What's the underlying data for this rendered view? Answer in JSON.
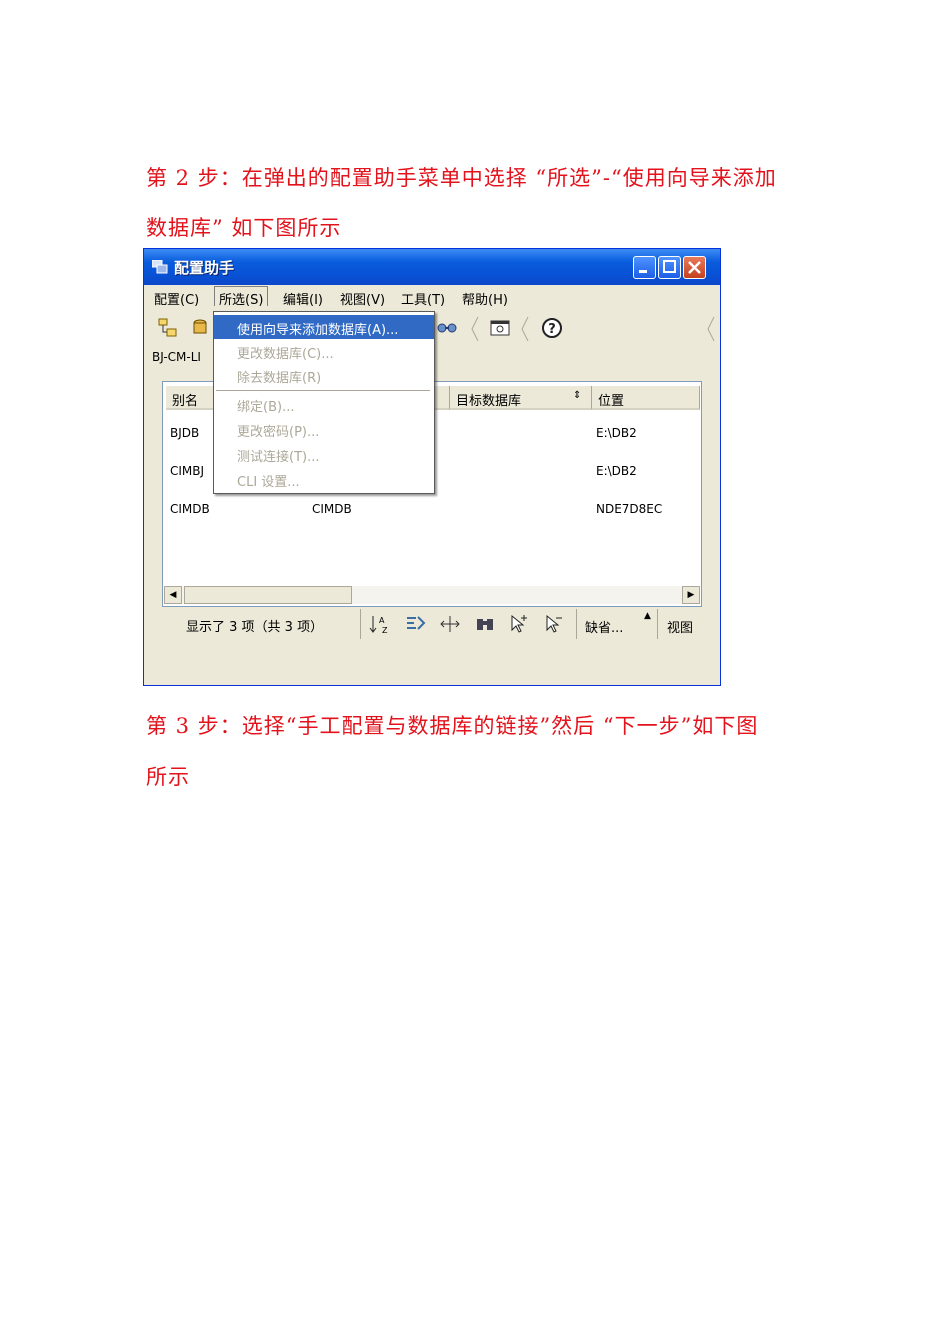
{
  "doc": {
    "step2_line1": "第 2 步：在弹出的配置助手菜单中选择 “所选”-“使用向导来添加",
    "step2_line2": "数据库” 如下图所示",
    "step3_line1": "第 3 步：选择“手工配置与数据库的链接”然后 “下一步”如下图",
    "step3_line2": "所示"
  },
  "window": {
    "title": "配置助手",
    "colors": {
      "title_bar": "#0a5ddd",
      "highlight": "#316ac5",
      "doc_text": "#e3121b"
    }
  },
  "menubar": [
    "配置(C)",
    "所选(S)",
    "编辑(I)",
    "视图(V)",
    "工具(T)",
    "帮助(H)"
  ],
  "dropdown": {
    "items": [
      {
        "label": "使用向导来添加数据库(A)...",
        "enabled": true
      },
      {
        "label": "更改数据库(C)...",
        "enabled": false
      },
      {
        "label": "除去数据库(R)",
        "enabled": false
      },
      {
        "label": "绑定(B)...",
        "enabled": false
      },
      {
        "label": "更改密码(P)...",
        "enabled": false
      },
      {
        "label": "测试连接(T)...",
        "enabled": false
      },
      {
        "label": "CLI 设置...",
        "enabled": false
      }
    ]
  },
  "system_label": "BJ-CM-LI",
  "table": {
    "headers": [
      "别名",
      "目标数据库",
      "位置"
    ],
    "rows": [
      {
        "alias": "BJDB",
        "target": "",
        "location": "E:\\DB2"
      },
      {
        "alias": "CIMBJ",
        "target": "",
        "location": "E:\\DB2"
      },
      {
        "alias": "CIMDB",
        "target": "CIMDB",
        "location": "NDE7D8EC"
      }
    ]
  },
  "status": {
    "text": "显示了 3 项（共 3 项）",
    "default_label": "缺省...",
    "view_label": "视图"
  }
}
